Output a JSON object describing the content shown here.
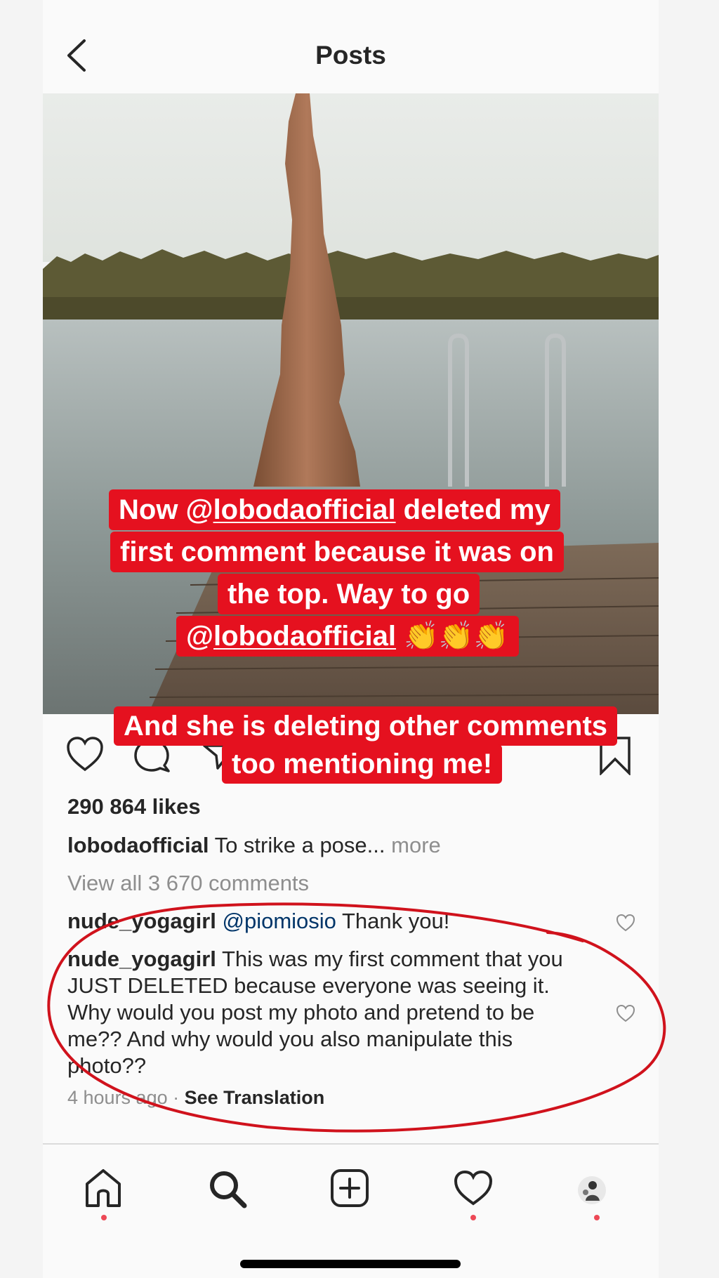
{
  "header": {
    "title": "Posts",
    "back_icon": "chevron-left-icon"
  },
  "post": {
    "image_description_icon": "post-photo",
    "overlay_text_1": {
      "line1_prefix": "Now @",
      "line1_mention": "lobodaofficial",
      "line1_suffix": " deleted my",
      "line2": "first comment because it was on",
      "line3": "the top. Way to go",
      "line4_prefix": "@",
      "line4_mention": "lobodaofficial",
      "line4_emoji": " 👏👏👏"
    },
    "overlay_text_2": {
      "line1": "And she is deleting other comments",
      "line2": "too mentioning me!"
    },
    "likes": "290 864 likes",
    "caption_user": "lobodaofficial",
    "caption_text": "To strike a pose...",
    "caption_more": "more",
    "view_all": "View all 3 670 comments"
  },
  "comments": [
    {
      "user": "nude_yogagirl",
      "mention": "@piomiosio",
      "text": "Thank you!"
    },
    {
      "user": "nude_yogagirl",
      "text": "This was my first comment that you JUST DELETED because everyone was seeing it. Why would you post my photo and pretend to be me?? And why would you also manipulate this photo??"
    }
  ],
  "meta": {
    "time": "4 hours ago",
    "separator": " · ",
    "see_translation": "See Translation"
  },
  "actions": {
    "like_icon": "heart-icon",
    "comment_icon": "comment-icon",
    "share_icon": "share-icon",
    "save_icon": "bookmark-icon"
  },
  "bottom_nav": {
    "items": [
      "home-icon",
      "search-icon",
      "add-post-icon",
      "activity-heart-icon",
      "profile-avatar"
    ],
    "notification_color": "#ed4956"
  },
  "colors": {
    "sticker_red": "#e5111f",
    "annotation_red": "#d0121c",
    "text_dark": "#262626",
    "text_muted": "#8e8e8e",
    "mention_blue": "#003569"
  }
}
